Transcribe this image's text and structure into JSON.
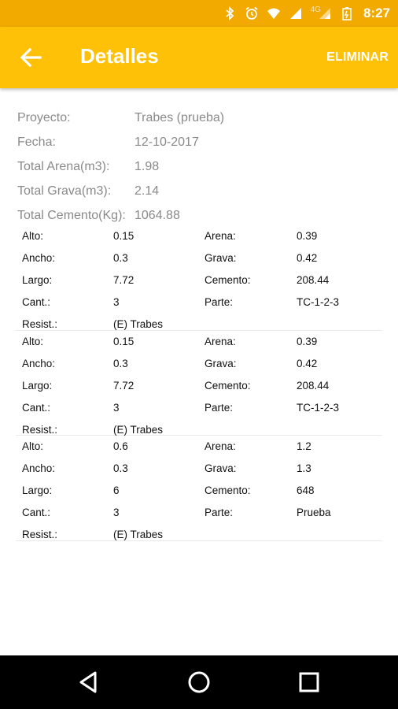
{
  "status_bar": {
    "time": "8:27",
    "network": "4G",
    "icons": [
      "bluetooth-icon",
      "alarm-icon",
      "wifi-icon",
      "cell-signal-icon",
      "cell-signal-4g-icon",
      "battery-charging-icon"
    ]
  },
  "app_bar": {
    "title": "Detalles",
    "action": "ELIMINAR",
    "back_icon": "back-arrow-icon",
    "color": "#ffc107"
  },
  "summary": [
    {
      "label": "Proyecto:",
      "value": "Trabes (prueba)"
    },
    {
      "label": "Fecha:",
      "value": "12-10-2017"
    },
    {
      "label": "Total Arena(m3):",
      "value": "1.98"
    },
    {
      "label": "Total Grava(m3):",
      "value": "2.14"
    },
    {
      "label": "Total Cemento(Kg):",
      "value": "1064.88"
    }
  ],
  "records": [
    {
      "rows": [
        [
          "Alto:",
          "0.15",
          "Arena:",
          "0.39"
        ],
        [
          "Ancho:",
          "0.3",
          "Grava:",
          "0.42"
        ],
        [
          "Largo:",
          "7.72",
          "Cemento:",
          "208.44"
        ],
        [
          "Cant.:",
          "3",
          "Parte:",
          "TC-1-2-3"
        ],
        [
          "Resist.:",
          "(E) Trabes",
          "",
          ""
        ]
      ]
    },
    {
      "rows": [
        [
          "Alto:",
          "0.15",
          "Arena:",
          "0.39"
        ],
        [
          "Ancho:",
          "0.3",
          "Grava:",
          "0.42"
        ],
        [
          "Largo:",
          "7.72",
          "Cemento:",
          "208.44"
        ],
        [
          "Cant.:",
          "3",
          "Parte:",
          "TC-1-2-3"
        ],
        [
          "Resist.:",
          "(E) Trabes",
          "",
          ""
        ]
      ]
    },
    {
      "rows": [
        [
          "Alto:",
          "0.6",
          "Arena:",
          "1.2"
        ],
        [
          "Ancho:",
          "0.3",
          "Grava:",
          "1.3"
        ],
        [
          "Largo:",
          "6",
          "Cemento:",
          "648"
        ],
        [
          "Cant.:",
          "3",
          "Parte:",
          "Prueba"
        ],
        [
          "Resist.:",
          "(E) Trabes",
          "",
          ""
        ]
      ]
    }
  ],
  "nav_bar": {
    "buttons": [
      "back-triangle-icon",
      "home-circle-icon",
      "recents-square-icon"
    ]
  }
}
